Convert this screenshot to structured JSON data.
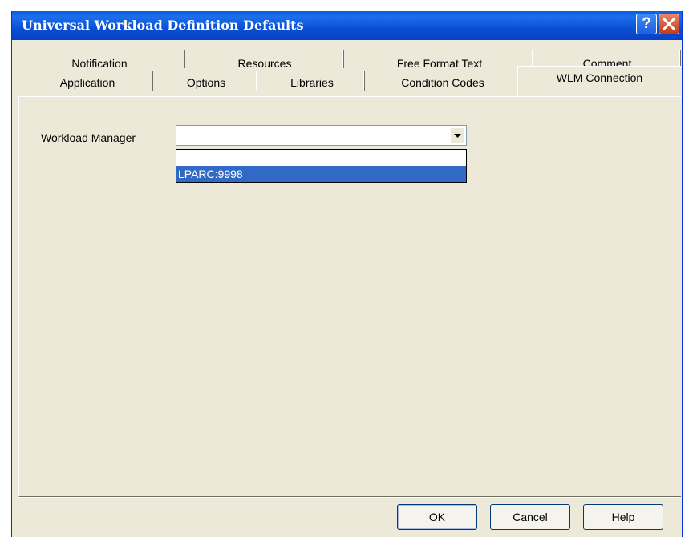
{
  "window": {
    "title": "Universal Workload Definition Defaults",
    "help_icon": "question-mark-icon",
    "close_icon": "close-x-icon"
  },
  "tabs": {
    "row_back": [
      {
        "label": "Notification"
      },
      {
        "label": "Resources"
      },
      {
        "label": "Free Format Text"
      },
      {
        "label": "Comment"
      }
    ],
    "row_front": [
      {
        "label": "Application"
      },
      {
        "label": "Options"
      },
      {
        "label": "Libraries"
      },
      {
        "label": "Condition Codes"
      },
      {
        "label": "WLM Connection",
        "active": true
      }
    ]
  },
  "form": {
    "workload_manager_label": "Workload Manager",
    "workload_manager_value": "",
    "dropdown_options": [
      "",
      "LPARC:9998"
    ],
    "highlighted_option": "LPARC:9998"
  },
  "buttons": {
    "ok": "OK",
    "cancel": "Cancel",
    "help": "Help"
  },
  "colors": {
    "titlebar": "#0A4FD6",
    "dialog_bg": "#ECE9D8",
    "selection": "#316AC5"
  }
}
